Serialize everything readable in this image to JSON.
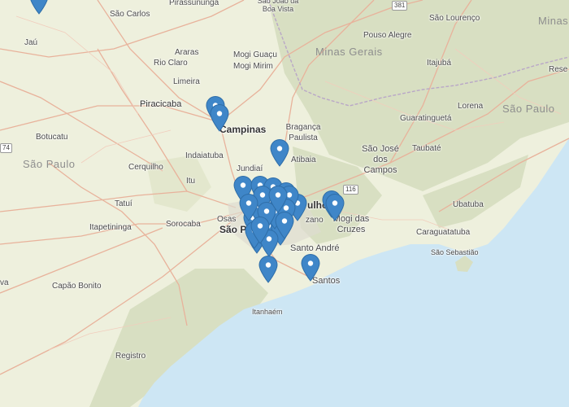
{
  "map": {
    "colors": {
      "land": "#eef0dd",
      "terrain": "#d7dfc0",
      "ocean": "#cde6f4",
      "roads": "#e8b29b",
      "marker": "#3f86c8"
    },
    "regions": [
      {
        "id": "minas-gerais",
        "label": "Minas Gerais"
      },
      {
        "id": "sao-paulo-east",
        "label": "São Paulo"
      },
      {
        "id": "sao-paulo-west",
        "label": "São Paulo"
      },
      {
        "id": "minas-corner",
        "label": "Minas"
      }
    ],
    "places": [
      {
        "id": "sao-carlos",
        "label": "São Carlos"
      },
      {
        "id": "pirassununga",
        "label": "Pirassununga"
      },
      {
        "id": "sao-joao-boa-vista",
        "label": "São João da Boa Vista"
      },
      {
        "id": "sao-lourenco",
        "label": "São Lourenço"
      },
      {
        "id": "jau",
        "label": "Jaú"
      },
      {
        "id": "pouso-alegre",
        "label": "Pouso Alegre"
      },
      {
        "id": "araras",
        "label": "Araras"
      },
      {
        "id": "mogi-guacu",
        "label": "Mogi Guaçu"
      },
      {
        "id": "rio-claro",
        "label": "Rio Claro"
      },
      {
        "id": "mogi-mirim",
        "label": "Mogi Mirim"
      },
      {
        "id": "itajuba",
        "label": "Itajubá"
      },
      {
        "id": "limeira",
        "label": "Limeira"
      },
      {
        "id": "resende",
        "label": "Rese"
      },
      {
        "id": "piracicaba",
        "label": "Piracicaba"
      },
      {
        "id": "lorena",
        "label": "Lorena"
      },
      {
        "id": "campinas",
        "label": "Campinas"
      },
      {
        "id": "braganca-paulista",
        "label": "Bragança Paulista"
      },
      {
        "id": "guaratingueta",
        "label": "Guaratinguetá"
      },
      {
        "id": "botucatu",
        "label": "Botucatu"
      },
      {
        "id": "taubate",
        "label": "Taubaté"
      },
      {
        "id": "sao-jose-dos-campos",
        "label": "São José dos Campos"
      },
      {
        "id": "indaiatuba",
        "label": "Indaiatuba"
      },
      {
        "id": "atibaia",
        "label": "Atibaia"
      },
      {
        "id": "cerquilho",
        "label": "Cerquilho"
      },
      {
        "id": "jundiai",
        "label": "Jundiaí"
      },
      {
        "id": "itu",
        "label": "Itu"
      },
      {
        "id": "guarulhos",
        "label": "ulho"
      },
      {
        "id": "ubatuba",
        "label": "Ubatuba"
      },
      {
        "id": "tatui",
        "label": "Tatuí"
      },
      {
        "id": "itapetininga",
        "label": "Itapetininga"
      },
      {
        "id": "sorocaba",
        "label": "Sorocaba"
      },
      {
        "id": "osasco",
        "label": "Osas"
      },
      {
        "id": "sao-paulo",
        "label": "São Pa"
      },
      {
        "id": "zano",
        "label": "zano"
      },
      {
        "id": "mogi-das-cruzes",
        "label": "Mogi das Cruzes"
      },
      {
        "id": "caraguatatuba",
        "label": "Caraguatatuba"
      },
      {
        "id": "santo-andre",
        "label": "Santo André"
      },
      {
        "id": "sao-sebastiao",
        "label": "São Sebastião"
      },
      {
        "id": "capao-bonito",
        "label": "Capão Bonito"
      },
      {
        "id": "santos",
        "label": "Santos"
      },
      {
        "id": "itanhaem",
        "label": "Itanhaém"
      },
      {
        "id": "registro",
        "label": "Registro"
      },
      {
        "id": "va",
        "label": "va"
      }
    ],
    "shields": [
      {
        "id": "shield-381",
        "label": "381"
      },
      {
        "id": "shield-116",
        "label": "116"
      },
      {
        "id": "shield-74",
        "label": "74"
      }
    ]
  }
}
